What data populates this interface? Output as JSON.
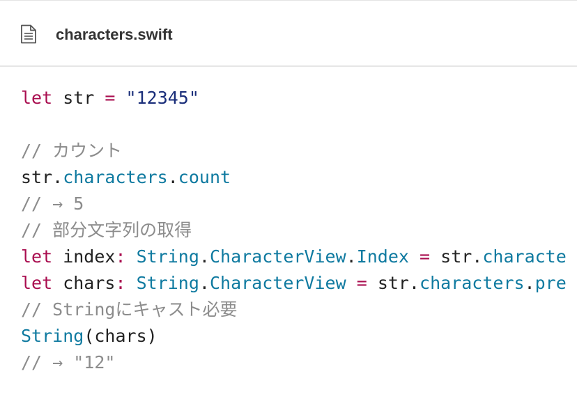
{
  "header": {
    "file_icon": "document-icon",
    "filename": "characters.swift"
  },
  "colors": {
    "keyword": "#a90d4f",
    "string": "#1a2e7a",
    "type": "#0f7aa0",
    "comment": "#8c8c8c",
    "plain": "#222222"
  },
  "code": {
    "lines": [
      [
        {
          "t": "let",
          "k": "kw"
        },
        {
          "t": " str ",
          "k": "plain"
        },
        {
          "t": "=",
          "k": "kw"
        },
        {
          "t": " ",
          "k": "plain"
        },
        {
          "t": "\"12345\"",
          "k": "str"
        }
      ],
      [],
      [
        {
          "t": "// カウント",
          "k": "cmt"
        }
      ],
      [
        {
          "t": "str.",
          "k": "plain"
        },
        {
          "t": "characters",
          "k": "type"
        },
        {
          "t": ".",
          "k": "plain"
        },
        {
          "t": "count",
          "k": "type"
        }
      ],
      [
        {
          "t": "// → 5",
          "k": "cmt"
        }
      ],
      [
        {
          "t": "// 部分文字列の取得",
          "k": "cmt"
        }
      ],
      [
        {
          "t": "let",
          "k": "kw"
        },
        {
          "t": " index",
          "k": "plain"
        },
        {
          "t": ":",
          "k": "kw"
        },
        {
          "t": " ",
          "k": "plain"
        },
        {
          "t": "String",
          "k": "type"
        },
        {
          "t": ".",
          "k": "plain"
        },
        {
          "t": "CharacterView",
          "k": "type"
        },
        {
          "t": ".",
          "k": "plain"
        },
        {
          "t": "Index",
          "k": "type"
        },
        {
          "t": " ",
          "k": "plain"
        },
        {
          "t": "=",
          "k": "kw"
        },
        {
          "t": " str.",
          "k": "plain"
        },
        {
          "t": "characte",
          "k": "type"
        }
      ],
      [
        {
          "t": "let",
          "k": "kw"
        },
        {
          "t": " chars",
          "k": "plain"
        },
        {
          "t": ":",
          "k": "kw"
        },
        {
          "t": " ",
          "k": "plain"
        },
        {
          "t": "String",
          "k": "type"
        },
        {
          "t": ".",
          "k": "plain"
        },
        {
          "t": "CharacterView",
          "k": "type"
        },
        {
          "t": " ",
          "k": "plain"
        },
        {
          "t": "=",
          "k": "kw"
        },
        {
          "t": " str.",
          "k": "plain"
        },
        {
          "t": "characters",
          "k": "type"
        },
        {
          "t": ".",
          "k": "plain"
        },
        {
          "t": "pre",
          "k": "type"
        }
      ],
      [
        {
          "t": "// Stringにキャスト必要",
          "k": "cmt"
        }
      ],
      [
        {
          "t": "String",
          "k": "type"
        },
        {
          "t": "(chars)",
          "k": "plain"
        }
      ],
      [
        {
          "t": "// → \"12\"",
          "k": "cmt"
        }
      ]
    ]
  }
}
